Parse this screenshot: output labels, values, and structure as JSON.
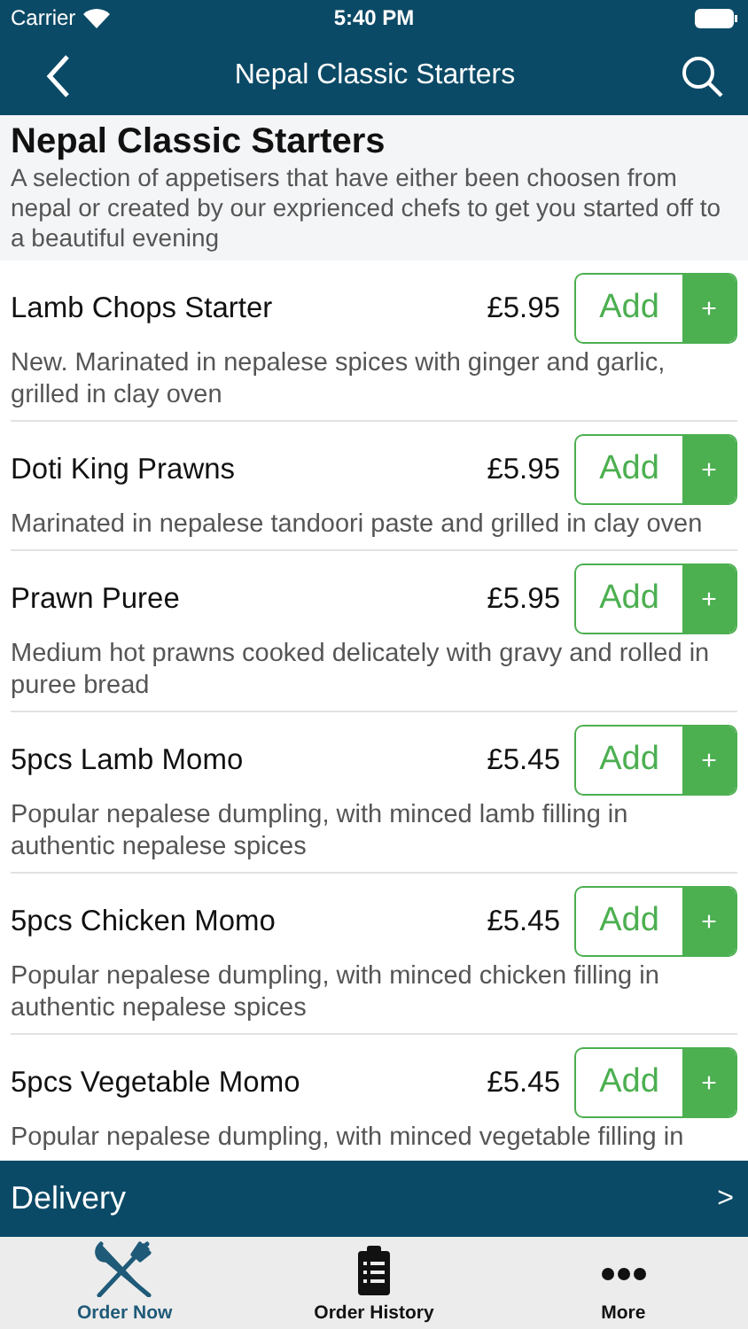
{
  "status_bar": {
    "carrier": "Carrier",
    "time": "5:40 PM"
  },
  "nav": {
    "title": "Nepal Classic Starters"
  },
  "category": {
    "title": "Nepal Classic Starters",
    "description": "A selection of appetisers that have either been choosen from nepal or created by our exprienced chefs to get you started off to a beautiful evening"
  },
  "items": [
    {
      "name": "Lamb Chops Starter",
      "price": "£5.95",
      "button": "Add",
      "plus": "+",
      "description": "New. Marinated in nepalese spices with ginger and garlic, grilled in clay oven"
    },
    {
      "name": "Doti King Prawns",
      "price": "£5.95",
      "button": "Add",
      "plus": "+",
      "description": "Marinated in nepalese tandoori paste and grilled in clay oven"
    },
    {
      "name": "Prawn Puree",
      "price": "£5.95",
      "button": "Add",
      "plus": "+",
      "description": "Medium hot prawns cooked delicately with gravy and rolled in puree bread"
    },
    {
      "name": "5pcs Lamb Momo",
      "price": "£5.45",
      "button": "Add",
      "plus": "+",
      "description": "Popular nepalese dumpling, with minced lamb filling in authentic nepalese spices"
    },
    {
      "name": "5pcs Chicken Momo",
      "price": "£5.45",
      "button": "Add",
      "plus": "+",
      "description": "Popular nepalese dumpling, with minced chicken filling in authentic nepalese spices"
    },
    {
      "name": "5pcs Vegetable Momo",
      "price": "£5.45",
      "button": "Add",
      "plus": "+",
      "description": "Popular nepalese dumpling, with minced vegetable filling in"
    }
  ],
  "delivery_bar": {
    "label": "Delivery",
    "chevron": ">"
  },
  "tab_bar": [
    {
      "label": "Order Now",
      "kind": "cutlery",
      "selected": true
    },
    {
      "label": "Order History",
      "kind": "clipboard",
      "selected": false
    },
    {
      "label": "More",
      "kind": "dots",
      "selected": false
    }
  ]
}
